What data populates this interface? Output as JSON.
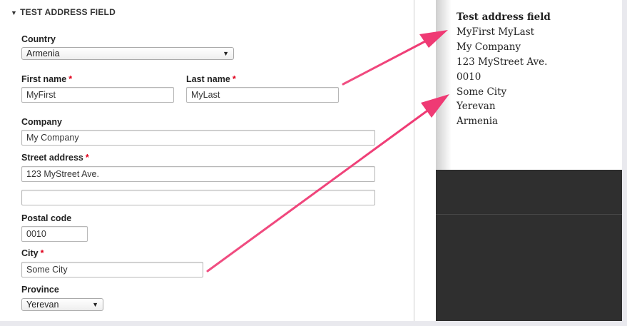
{
  "form": {
    "fieldset_title": "TEST ADDRESS FIELD",
    "country": {
      "label": "Country",
      "value": "Armenia"
    },
    "first_name": {
      "label": "First name",
      "required_mark": "*",
      "value": "MyFirst"
    },
    "last_name": {
      "label": "Last name",
      "required_mark": "*",
      "value": "MyLast"
    },
    "company": {
      "label": "Company",
      "value": "My Company"
    },
    "street": {
      "label": "Street address",
      "required_mark": "*",
      "value": "123 MyStreet Ave.",
      "line2_value": ""
    },
    "postal_code": {
      "label": "Postal code",
      "value": "0010"
    },
    "city": {
      "label": "City",
      "required_mark": "*",
      "value": "Some City"
    },
    "province": {
      "label": "Province",
      "value": "Yerevan"
    }
  },
  "preview": {
    "title": "Test address field",
    "lines": [
      "MyFirst MyLast",
      "My Company",
      "123 MyStreet Ave.",
      "0010",
      "Some City",
      "Yerevan",
      "Armenia"
    ]
  },
  "colors": {
    "required": "#e0001b",
    "arrow": "#f0407a",
    "dark_panel": "#2f2f2f"
  },
  "icons": {
    "collapse": "triangle-down-icon",
    "select_arrow": "chevron-down-icon"
  }
}
